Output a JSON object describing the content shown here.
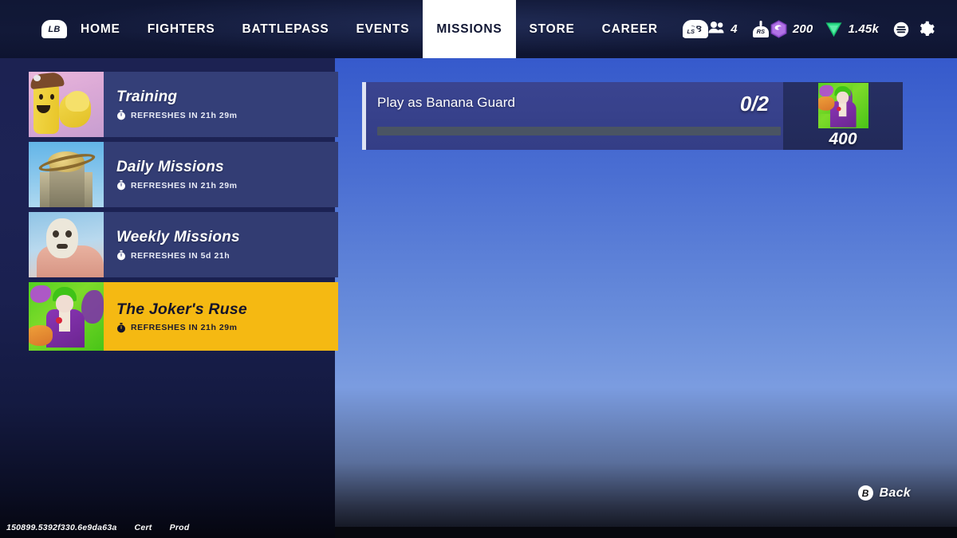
{
  "topbar": {
    "left_bumper": "LB",
    "right_bumper": "RB",
    "nav_items": [
      {
        "label": "HOME",
        "active": false
      },
      {
        "label": "FIGHTERS",
        "active": false
      },
      {
        "label": "BATTLEPASS",
        "active": false
      },
      {
        "label": "EVENTS",
        "active": false
      },
      {
        "label": "MISSIONS",
        "active": true
      },
      {
        "label": "STORE",
        "active": false
      },
      {
        "label": "CAREER",
        "active": false
      }
    ],
    "status": {
      "left_stick_label": "LS",
      "right_stick_label": "RS",
      "players_icon": "people-icon",
      "players_count": "4",
      "gem_icon": "purple-hex-gem-icon",
      "gem_amount": "200",
      "token_icon": "green-triangle-token-icon",
      "token_amount": "1.45k",
      "menu_icon": "list-menu-icon",
      "settings_icon": "gear-icon"
    }
  },
  "sidebar": {
    "cards": [
      {
        "title": "Training",
        "refresh": "REFRESHES IN 21h 29m",
        "thumb": "banana-guard-flexing-thumbnail",
        "selected": false
      },
      {
        "title": "Daily Missions",
        "refresh": "REFRESHES IN 21h 29m",
        "thumb": "daily-planet-building-thumbnail",
        "selected": false
      },
      {
        "title": "Weekly Missions",
        "refresh": "REFRESHES IN 5d 21h",
        "thumb": "jason-hockey-mask-thumbnail",
        "selected": false
      },
      {
        "title": "The Joker's Ruse",
        "refresh": "REFRESHES IN 21h 29m",
        "thumb": "joker-thumbnail",
        "selected": true
      }
    ]
  },
  "main": {
    "missions": [
      {
        "title": "Play as Banana Guard",
        "progress_text": "0/2",
        "progress_percent": 0,
        "reward_amount": "400",
        "reward_icon": "joker-reward-thumbnail"
      }
    ]
  },
  "footer": {
    "back_glyph": "B",
    "back_label": "Back",
    "build_id": "150899.5392f330.6e9da63a",
    "build_stage": "Cert",
    "build_env": "Prod"
  },
  "colors": {
    "accent_yellow": "#f5b912",
    "panel_blue": "#3a4490",
    "topbar_navy": "#101735",
    "sidebar_navy": "#1b2150"
  }
}
